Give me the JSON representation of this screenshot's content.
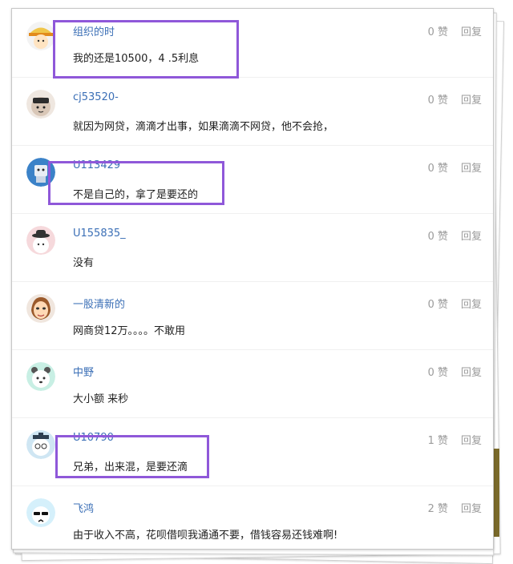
{
  "comments": [
    {
      "username": "组织的时",
      "text": "我的还是10500，4 .5利息",
      "likes": "0 赞",
      "reply": "回复"
    },
    {
      "username": "cj53520-",
      "text": "就因为网贷，滴滴才出事，如果滴滴不网贷，他不会抢，",
      "likes": "0 赞",
      "reply": "回复"
    },
    {
      "username": "U113429",
      "text": "不是自己的，拿了是要还的",
      "likes": "0 赞",
      "reply": "回复"
    },
    {
      "username": "U155835_",
      "text": "没有",
      "likes": "0 赞",
      "reply": "回复"
    },
    {
      "username": "一股清新的",
      "text": "网商贷12万。。。。不敢用",
      "likes": "0 赞",
      "reply": "回复"
    },
    {
      "username": "中野",
      "text": "大小额 来秒",
      "likes": "0 赞",
      "reply": "回复"
    },
    {
      "username": "U10790",
      "text": "兄弟，出来混，是要还滴",
      "likes": "1 赞",
      "reply": "回复"
    },
    {
      "username": "飞鸿",
      "text": "由于收入不高，花呗借呗我通通不要，借钱容易还钱难啊!",
      "likes": "2 赞",
      "reply": "回复"
    }
  ],
  "colors": {
    "username": "#3b6fb6",
    "meta": "#9b9b9b",
    "highlight": "#8f58d9"
  },
  "avatars": [
    "anime-hat-avatar-icon",
    "pilot-cat-avatar-icon",
    "robot-toy-avatar-icon",
    "bowler-hat-bear-avatar-icon",
    "cartoon-woman-avatar-icon",
    "teal-bear-avatar-icon",
    "glasses-bear-avatar-icon",
    "sunglasses-bear-avatar-icon"
  ]
}
